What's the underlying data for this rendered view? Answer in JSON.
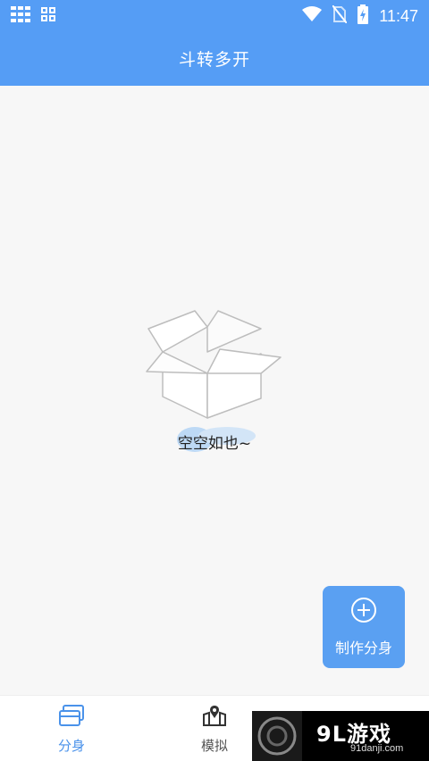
{
  "status_bar": {
    "time": "11:47",
    "icons": [
      "grid-icon",
      "apps-icon",
      "wifi-icon",
      "no-sim-icon",
      "battery-charging-icon"
    ]
  },
  "app_bar": {
    "title": "斗转多开"
  },
  "empty_state": {
    "text": "空空如也~",
    "icon": "open-box-icon"
  },
  "fab": {
    "label": "制作分身",
    "icon": "plus-circle-icon"
  },
  "bottom_nav": {
    "items": [
      {
        "label": "分身",
        "icon": "cards-icon",
        "active": true
      },
      {
        "label": "模拟",
        "icon": "map-pin-icon",
        "active": false
      },
      {
        "label": "",
        "icon": "profile-icon",
        "active": false
      }
    ]
  },
  "watermark": {
    "brand": "9L游戏",
    "url": "91danji.com"
  },
  "colors": {
    "primary": "#559df5",
    "active_tab": "#4a92ea",
    "background": "#f7f7f7"
  }
}
